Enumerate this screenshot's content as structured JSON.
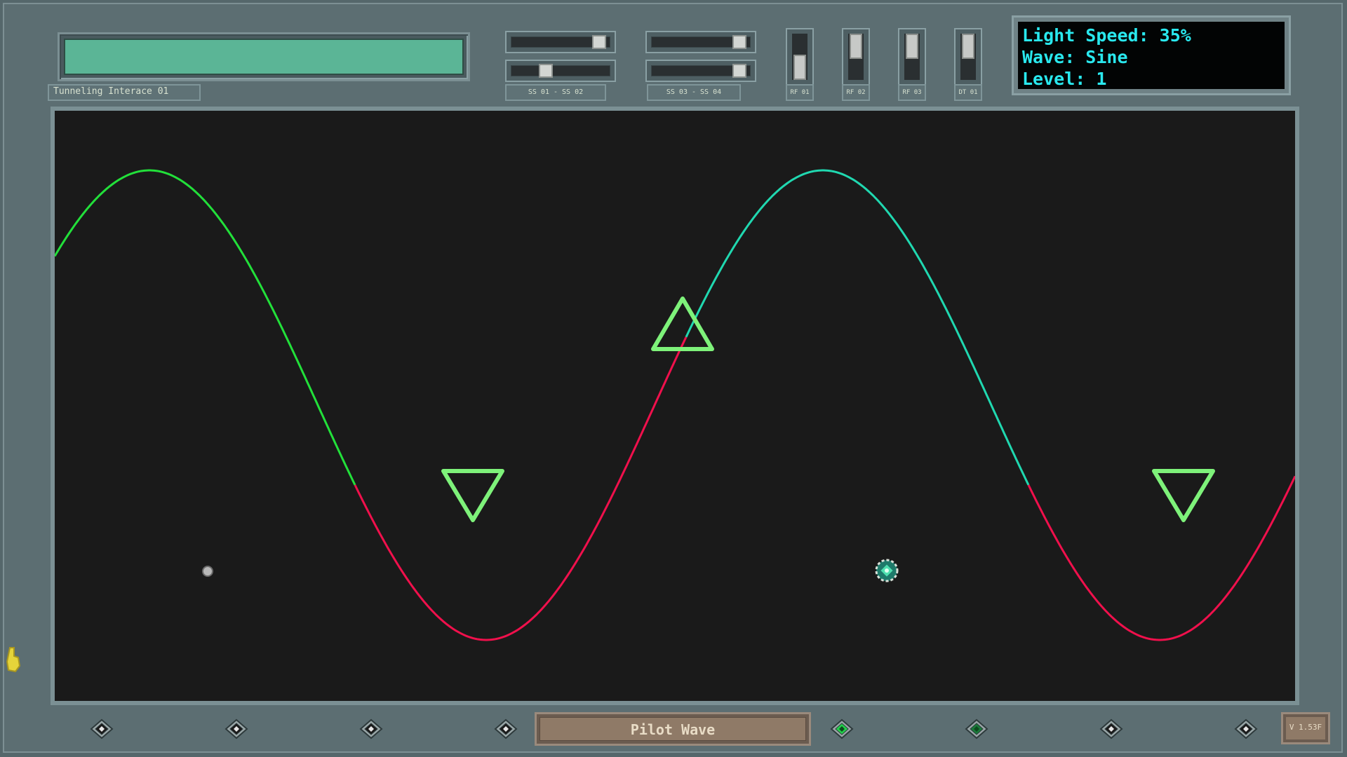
{
  "header": {
    "interface_label": "Tunneling Interace 01",
    "slider_group_1_label": "SS 01  -  SS 02",
    "slider_group_2_label": "SS 03  -  SS 04",
    "vertical_sliders": [
      {
        "label": "RF 01",
        "level": 0.3
      },
      {
        "label": "RF 02",
        "level": 0.8
      },
      {
        "label": "RF 03",
        "level": 0.8
      },
      {
        "label": "DT 01",
        "level": 0.8
      }
    ],
    "horizontal_sliders": [
      {
        "id": "SS 01",
        "level": 0.9
      },
      {
        "id": "SS 02",
        "level": 0.35
      },
      {
        "id": "SS 03",
        "level": 0.9
      },
      {
        "id": "SS 04",
        "level": 0.9
      }
    ]
  },
  "status": {
    "light_speed": "Light Speed: 35%",
    "wave": "Wave: Sine",
    "level": "Level: 1"
  },
  "playfield": {
    "wave_type": "sine",
    "colors": {
      "background": "#1a1a1a",
      "wave_upper": "#f0104c",
      "wave_lower_left": "#22e03a",
      "wave_lower_right": "#20d8b0",
      "triangle": "#7ef27a"
    },
    "triangles": [
      {
        "direction": "down"
      },
      {
        "direction": "up"
      },
      {
        "direction": "down"
      }
    ]
  },
  "footer": {
    "pilot_label": "Pilot Wave",
    "version_label": "V 1.53F",
    "nodes": [
      {
        "state": "off"
      },
      {
        "state": "off"
      },
      {
        "state": "off"
      },
      {
        "state": "off"
      },
      {
        "state": "on"
      },
      {
        "state": "dim"
      },
      {
        "state": "off"
      },
      {
        "state": "off"
      }
    ]
  }
}
